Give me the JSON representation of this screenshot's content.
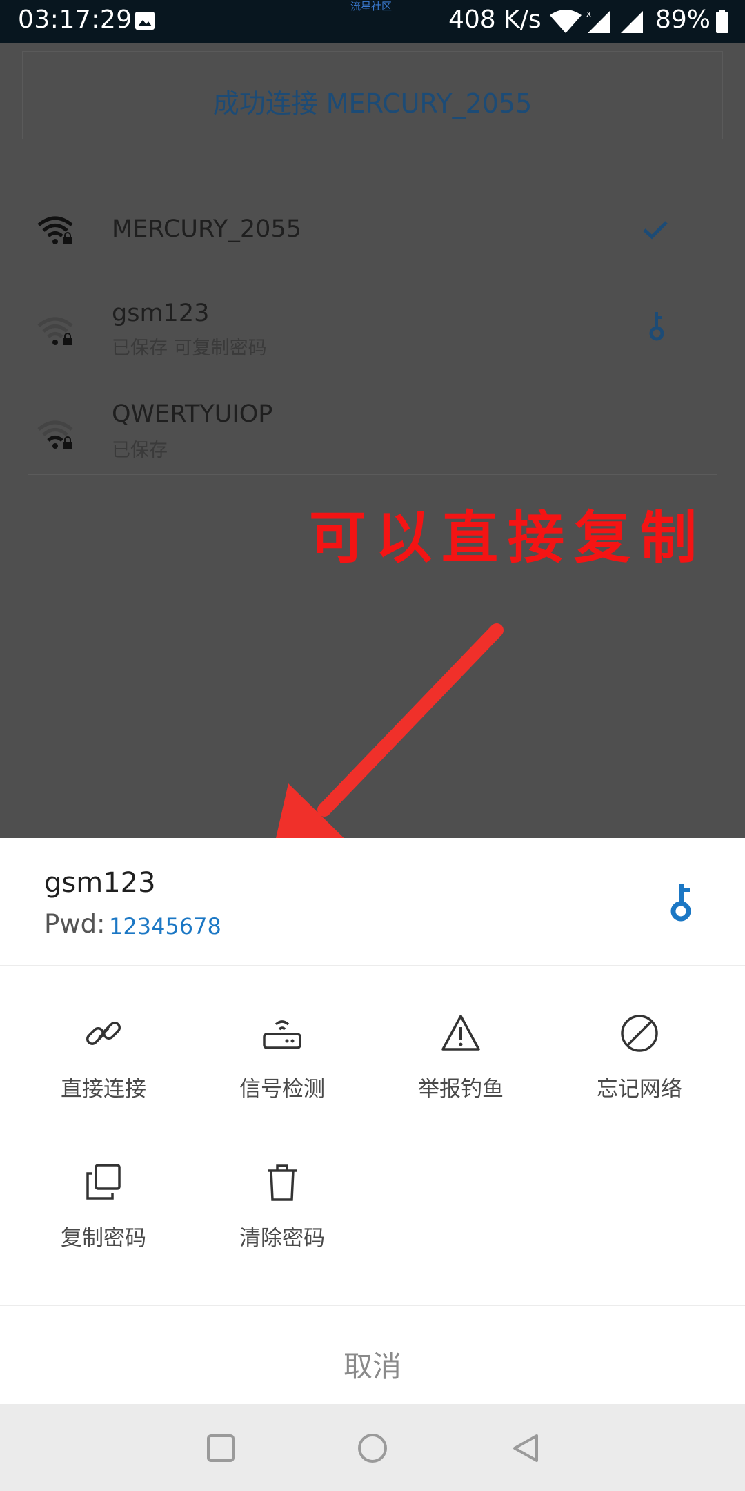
{
  "status_bar": {
    "time": "03:17:29",
    "watermark": "流星社区",
    "speed": "408 K/s",
    "battery": "89%"
  },
  "background": {
    "banner": "成功连接 MERCURY_2055",
    "networks": [
      {
        "ssid": "MERCURY_2055",
        "sub": "",
        "trail_icon": "check-icon"
      },
      {
        "ssid": "gsm123",
        "sub": "已保存 可复制密码",
        "trail_icon": "key-icon"
      },
      {
        "ssid": "QWERTYUIOP",
        "sub": "已保存",
        "trail_icon": ""
      }
    ],
    "annotation": "可以直接复制"
  },
  "sheet": {
    "ssid": "gsm123",
    "pwd_label": "Pwd:",
    "pwd_value": "12345678",
    "actions": [
      {
        "label": "直接连接",
        "icon": "link-icon"
      },
      {
        "label": "信号检测",
        "icon": "router-icon"
      },
      {
        "label": "举报钓鱼",
        "icon": "warning-icon"
      },
      {
        "label": "忘记网络",
        "icon": "block-icon"
      },
      {
        "label": "复制密码",
        "icon": "copy-icon"
      },
      {
        "label": "清除密码",
        "icon": "trash-icon"
      }
    ],
    "cancel": "取消"
  },
  "colors": {
    "accent": "#1b77c4",
    "annotation": "#f41414",
    "overlay": "#4f4f4f"
  }
}
